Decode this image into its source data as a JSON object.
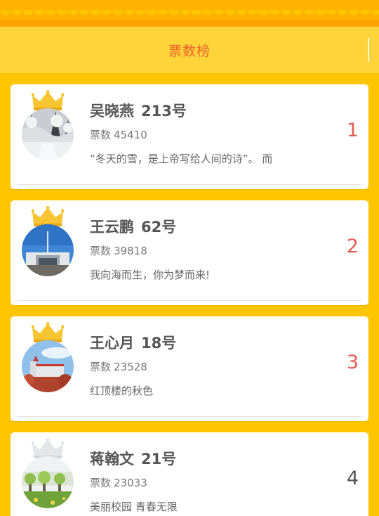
{
  "header": {
    "title": "票数榜"
  },
  "colors": {
    "background": "#FFC600",
    "header_title": "#F0642A",
    "rank_top": "#E55A4E",
    "rank_other": "#555555",
    "crown_gold": "#F6C531"
  },
  "labels": {
    "votes_prefix": "票数"
  },
  "entries": [
    {
      "rank": "1",
      "name": "吴晓燕",
      "number": "213号",
      "votes": "45410",
      "motto": "“冬天的雪，是上帝写给人间的诗”。 而",
      "avatar": "snowy-trees-photo",
      "crown": "gold"
    },
    {
      "rank": "2",
      "name": "王云鹏",
      "number": "62号",
      "votes": "39818",
      "motto": "我向海而生，你为梦而来!",
      "avatar": "campus-gate-photo",
      "crown": "gold"
    },
    {
      "rank": "3",
      "name": "王心月",
      "number": "18号",
      "votes": "23528",
      "motto": "红顶楼的秋色",
      "avatar": "red-building-autumn-photo",
      "crown": "gold"
    },
    {
      "rank": "4",
      "name": "蒋翰文",
      "number": "21号",
      "votes": "23033",
      "motto": "美丽校园 青春无限",
      "avatar": "green-campus-photo",
      "crown": "silver"
    }
  ]
}
